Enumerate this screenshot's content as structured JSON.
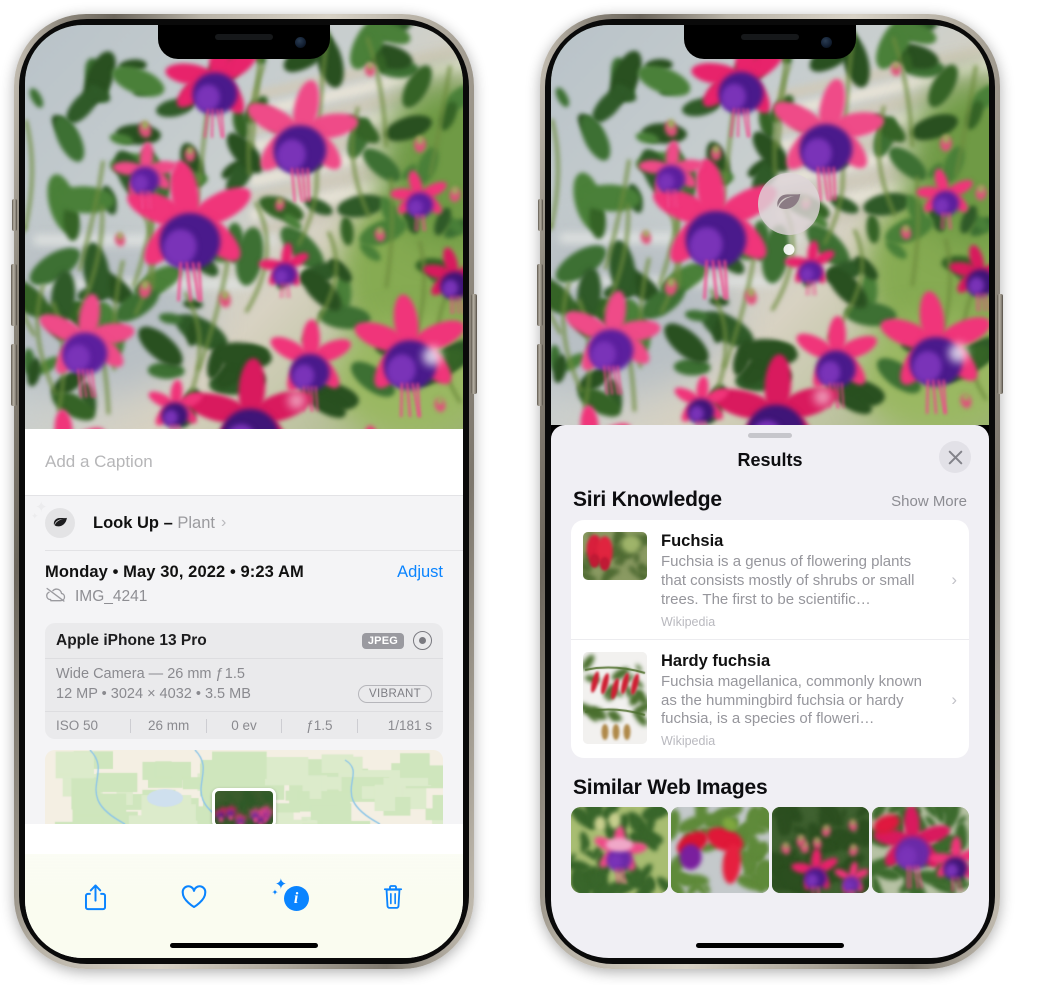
{
  "left_phone": {
    "photo": {
      "alt": "fuchsia-flowers-photo"
    },
    "caption": {
      "placeholder": "Add a Caption",
      "value": ""
    },
    "lookup": {
      "icon": "leaf-icon",
      "sparkle_icon": "sparkles-icon",
      "label": "Look Up – ",
      "subject": "Plant",
      "chevron": "›"
    },
    "metadata": {
      "date": "Monday • May 30, 2022 • 9:23 AM",
      "adjust_label": "Adjust",
      "cloud_icon": "cloud-slash-icon",
      "filename": "IMG_4241"
    },
    "camera_card": {
      "device": "Apple iPhone 13 Pro",
      "format_badge": "JPEG",
      "aperture_icon": "aperture-icon",
      "lens": "Wide Camera — 26 mm ƒ 1.5",
      "specs": "12 MP • 3024 × 4032 • 3.5 MB",
      "style_badge": "VIBRANT",
      "exif": [
        "ISO 50",
        "26 mm",
        "0 ev",
        "ƒ1.5",
        "1/181 s"
      ]
    },
    "map": {
      "label": "photo-location-map"
    },
    "toolbar": [
      {
        "name": "share-button",
        "icon": "share-icon"
      },
      {
        "name": "favorite-button",
        "icon": "heart-icon"
      },
      {
        "name": "info-button",
        "icon": "info-sparkle-icon",
        "glyph": "i"
      },
      {
        "name": "delete-button",
        "icon": "trash-icon"
      }
    ]
  },
  "right_phone": {
    "photo": {
      "alt": "fuchsia-flowers-photo"
    },
    "visual_lookup_badge": {
      "icon": "leaf-icon"
    },
    "sheet": {
      "grabber": "drag-handle",
      "title": "Results",
      "close_icon": "close-icon",
      "siri_knowledge": {
        "title": "Siri Knowledge",
        "show_more": "Show More",
        "items": [
          {
            "name": "Fuchsia",
            "description": "Fuchsia is a genus of flowering plants that consists mostly of shrubs or small trees. The first to be scientific…",
            "source": "Wikipedia",
            "chevron": "›"
          },
          {
            "name": "Hardy fuchsia",
            "description": "Fuchsia magellanica, commonly known as the hummingbird fuchsia or hardy fuchsia, is a species of floweri…",
            "source": "Wikipedia",
            "chevron": "›"
          }
        ]
      },
      "similar_web_images": {
        "title": "Similar Web Images",
        "thumbs": [
          "web-image-1",
          "web-image-2",
          "web-image-3",
          "web-image-4"
        ]
      }
    }
  },
  "colors": {
    "accent_blue": "#0a84ff",
    "sheet_bg": "#f0eff4",
    "card_bg": "#ffffff",
    "muted_text": "#8e8e93"
  }
}
